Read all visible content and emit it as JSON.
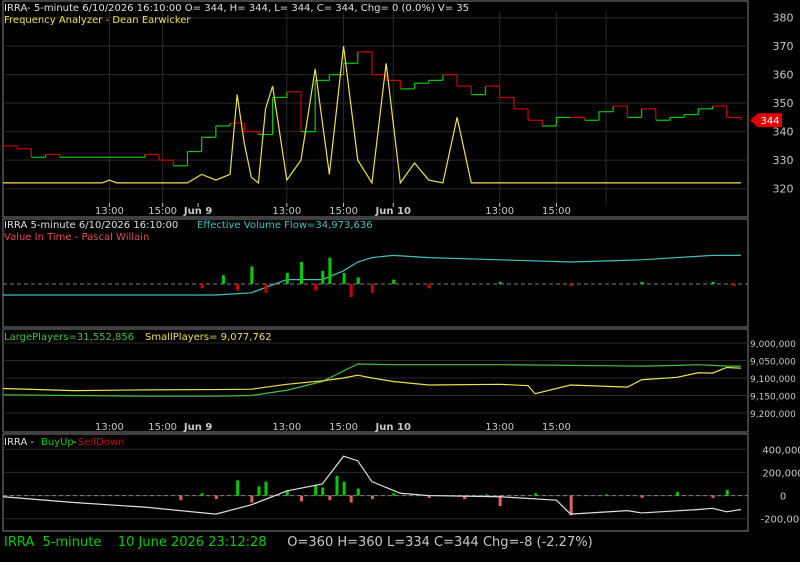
{
  "panel1": {
    "header_line1": "IRRA- 5-minute 6/10/2026 16:10:00 O= 344, H= 344, L= 344, C= 344, Chg= 0 (0.0%) V= 35",
    "header_line2": "Frequency Analyzer - Dean Earwicker",
    "last_price_tag": "344"
  },
  "panel2": {
    "header_symbol": "IRRA 5-minute  6/10/2026 16:10:00",
    "header_evf": "Effective Volume Flow=34,973,636",
    "header_line2": "Value In Time - Pascal Willain"
  },
  "panel3": {
    "large_players": "LargePlayers=31,552,856",
    "small_players": "SmallPlayers= 9,077,762"
  },
  "panel4": {
    "header_symbol": "IRRA - ",
    "header_buy": "BuyUp",
    "header_dash": "-",
    "header_sell": "SellDown"
  },
  "status": {
    "symbol": "IRRA",
    "interval": "5-minute",
    "datetime": "10 June 2026 23:12:28",
    "ohlc": "O=360  H=360  L=334  C=344  Chg=-8 (-2.27%)"
  },
  "colors": {
    "background": "#000000",
    "grid": "#2a2a2a",
    "up": "#00cc00",
    "down": "#cc0000",
    "yellow": "#f0e050",
    "cyan": "#40c0c0",
    "white": "#e0e0e0",
    "price_tag": "#e00000"
  },
  "chart_data": [
    {
      "type": "line",
      "title": "IRRA- 5-minute 6/10/2026 16:10:00",
      "y_ticks": [
        320,
        330,
        340,
        350,
        360,
        370,
        380
      ],
      "ylim": [
        316,
        382
      ],
      "x_tick_labels": [
        "13:00",
        "15:00",
        "Jun 9",
        "13:00",
        "15:00",
        "Jun 10",
        "13:00",
        "15:00"
      ],
      "series": [
        {
          "name": "price",
          "x": [
            0,
            4,
            8,
            12,
            16,
            20,
            24,
            28,
            32,
            36,
            40,
            44,
            48,
            52,
            56,
            60,
            64,
            68,
            72,
            76,
            80,
            84,
            88,
            92,
            96,
            100,
            104,
            108,
            112,
            116,
            120,
            124,
            128,
            132,
            136,
            140,
            144,
            148,
            152,
            156,
            160,
            164,
            168,
            172,
            176,
            180,
            184,
            188,
            192,
            196,
            200,
            204,
            208
          ],
          "values": [
            335,
            334,
            331,
            332,
            331,
            331,
            331,
            331,
            331,
            331,
            332,
            330,
            328,
            333,
            338,
            342,
            343,
            340,
            339,
            352,
            354,
            340,
            358,
            360,
            364,
            368,
            360,
            358,
            355,
            357,
            358,
            360,
            356,
            353,
            356,
            352,
            348,
            344,
            342,
            345,
            345,
            344,
            347,
            349,
            345,
            348,
            344,
            345,
            346,
            348,
            349,
            345,
            344
          ]
        },
        {
          "name": "Frequency Analyzer - Dean Earwicker",
          "x": [
            0,
            8,
            16,
            20,
            24,
            28,
            30,
            32,
            36,
            40,
            44,
            48,
            52,
            56,
            60,
            64,
            66,
            68,
            70,
            72,
            74,
            76,
            80,
            84,
            88,
            92,
            96,
            100,
            104,
            108,
            112,
            116,
            120,
            124,
            128,
            132,
            136,
            140,
            144,
            148,
            152,
            156,
            160,
            164,
            168,
            172,
            176,
            180,
            184,
            188,
            192,
            196,
            200,
            204,
            208
          ],
          "values": [
            322,
            322,
            322,
            322,
            322,
            322,
            323,
            322,
            322,
            322,
            322,
            322,
            322,
            325,
            323,
            325,
            353,
            336,
            324,
            322,
            348,
            356,
            323,
            330,
            362,
            325,
            370,
            330,
            322,
            364,
            322,
            329,
            323,
            322,
            345,
            322,
            322,
            322,
            322,
            322,
            322,
            322,
            322,
            322,
            322,
            322,
            322,
            322,
            322,
            322,
            322,
            322,
            322,
            322,
            322
          ]
        }
      ]
    },
    {
      "type": "bar",
      "title": "IRRA 5-minute  6/10/2026 16:10:00",
      "series": [
        {
          "name": "Effective Volume Flow",
          "x": [
            0,
            20,
            40,
            60,
            70,
            80,
            90,
            96,
            100,
            104,
            110,
            120,
            140,
            160,
            180,
            200,
            208
          ],
          "values": [
            -5,
            -5,
            -5,
            -5,
            -4,
            2,
            2,
            6,
            10,
            12,
            13,
            12,
            11,
            10,
            11,
            13,
            13
          ]
        },
        {
          "name": "Value In Time",
          "x": [
            56,
            62,
            66,
            70,
            74,
            80,
            84,
            88,
            90,
            92,
            96,
            98,
            100,
            104,
            110,
            120,
            140,
            160,
            180,
            200,
            206
          ],
          "values": [
            -2,
            4,
            -3,
            8,
            -4,
            5,
            10,
            -3,
            6,
            12,
            5,
            -6,
            3,
            -4,
            2,
            -2,
            1,
            -1,
            1,
            1,
            -1
          ]
        }
      ]
    },
    {
      "type": "line",
      "title": "LargePlayers / SmallPlayers",
      "y_ticks": [
        9000000,
        9050000,
        9100000,
        9150000,
        9200000
      ],
      "y_tick_labels": [
        "9,000,000",
        "9,050,000",
        "9,100,000",
        "9,150,000",
        "9,200,000"
      ],
      "ylim": [
        8980000,
        9220000
      ],
      "series": [
        {
          "name": "LargePlayers",
          "x": [
            0,
            20,
            40,
            60,
            70,
            80,
            90,
            96,
            100,
            110,
            120,
            140,
            160,
            180,
            190,
            196,
            200,
            204,
            208
          ],
          "values": [
            9148000,
            9150000,
            9152000,
            9152000,
            9150000,
            9135000,
            9110000,
            9080000,
            9060000,
            9062000,
            9062000,
            9062000,
            9064000,
            9066000,
            9064000,
            9062000,
            9064000,
            9066000,
            9066000
          ]
        },
        {
          "name": "SmallPlayers",
          "x": [
            0,
            20,
            40,
            60,
            70,
            80,
            90,
            96,
            100,
            104,
            110,
            120,
            140,
            148,
            150,
            160,
            176,
            180,
            190,
            196,
            200,
            204,
            208
          ],
          "values": [
            9130000,
            9136000,
            9134000,
            9133000,
            9132000,
            9118000,
            9108000,
            9100000,
            9092000,
            9100000,
            9110000,
            9120000,
            9118000,
            9122000,
            9145000,
            9120000,
            9126000,
            9105000,
            9098000,
            9085000,
            9086000,
            9070000,
            9072000
          ]
        }
      ]
    },
    {
      "type": "bar",
      "title": "IRRA - BuyUp-SellDown",
      "y_ticks": [
        -200000,
        0,
        200000,
        400000
      ],
      "y_tick_labels": [
        "-200,000",
        "0",
        "200,000",
        "400,000"
      ],
      "ylim": [
        -280000,
        480000
      ],
      "series": [
        {
          "name": "BuyUp-SellDown",
          "x": [
            0,
            20,
            40,
            60,
            70,
            80,
            90,
            96,
            100,
            104,
            108,
            112,
            120,
            140,
            156,
            160,
            176,
            180,
            196,
            200,
            204,
            208
          ],
          "values": [
            -10000,
            -60000,
            -100000,
            -160000,
            -80000,
            40000,
            100000,
            340000,
            300000,
            120000,
            70000,
            20000,
            0,
            -10000,
            -40000,
            -160000,
            -130000,
            -150000,
            -120000,
            -110000,
            -140000,
            -120000
          ]
        },
        {
          "name": "histogram",
          "x": [
            50,
            56,
            60,
            66,
            70,
            72,
            74,
            80,
            84,
            88,
            90,
            92,
            94,
            96,
            98,
            100,
            104,
            110,
            120,
            130,
            136,
            140,
            150,
            160,
            170,
            180,
            190,
            200,
            204
          ],
          "values": [
            -40000,
            20000,
            -30000,
            130000,
            -60000,
            80000,
            120000,
            40000,
            -50000,
            90000,
            70000,
            -40000,
            170000,
            120000,
            -60000,
            60000,
            -30000,
            20000,
            -20000,
            -30000,
            10000,
            -90000,
            20000,
            -170000,
            10000,
            -20000,
            30000,
            -20000,
            50000
          ]
        }
      ]
    }
  ]
}
